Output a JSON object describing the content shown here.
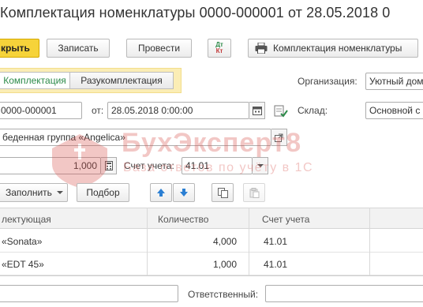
{
  "window": {
    "title": "Комплектация номенклатуры 0000-000001 от 28.05.2018 0"
  },
  "toolbar": {
    "post_close": "крыть",
    "save": "Записать",
    "post": "Провести",
    "dt_kt_top": "Дт",
    "dt_kt_bottom": "Кт",
    "print": "Комплектация номенклатуры"
  },
  "mode": {
    "assembly": "Комплектация",
    "disassembly": "Разукомплектация"
  },
  "header": {
    "org_label": "Организация:",
    "org_value": "Уютный дом",
    "number_value": "0000-000001",
    "from_label": "от:",
    "date_value": "28.05.2018  0:00:00",
    "warehouse_label": "Склад:",
    "warehouse_value": "Основной с",
    "item_value": "беденная группа «Angelica»",
    "qty_value": "1,000",
    "account_label": "Счет учета:",
    "account_value": "41.01"
  },
  "table_toolbar": {
    "fill": "Заполнить",
    "selection": "Подбор"
  },
  "table": {
    "columns": [
      "лектующая",
      "Количество",
      "Счет учета"
    ],
    "rows": [
      {
        "item": "«Sonata»",
        "qty": "4,000",
        "account": "41.01"
      },
      {
        "item": "«EDT 45»",
        "qty": "1,000",
        "account": "41.01"
      }
    ]
  },
  "footer": {
    "responsible_label": "Ответственный:"
  },
  "watermark": {
    "line1": "БухЭксперт8",
    "line2": "База ответов по учёту в 1С"
  },
  "colors": {
    "accent_yellow": "#f6d33a",
    "active_green": "#2d8b4a",
    "watermark_red": "#d9534f"
  }
}
